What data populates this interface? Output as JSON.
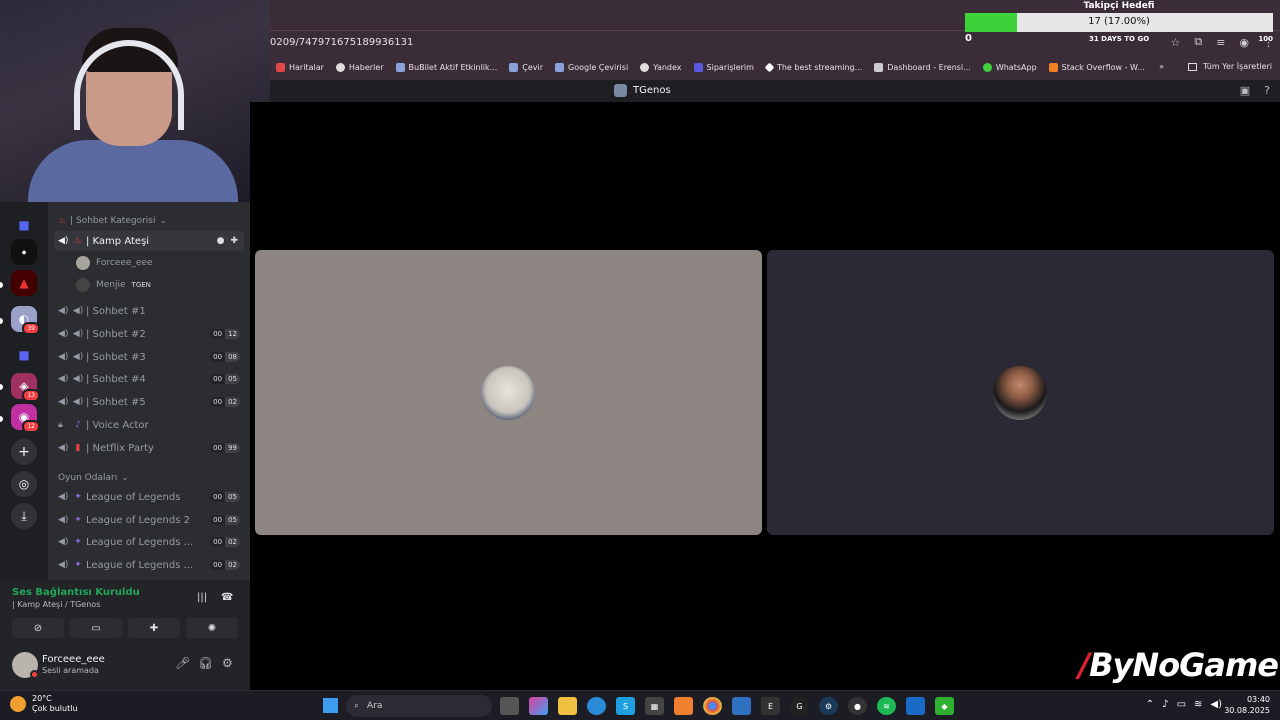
{
  "browser": {
    "address": "0209/747971675189936131",
    "bookmarks": [
      "Haritalar",
      "Haberler",
      "BuBilet Aktif Etkinlik...",
      "Çevir",
      "Google Çevirisi",
      "Yandex",
      "Siparişlerim",
      "The best streaming...",
      "Dashboard - Erensi...",
      "WhatsApp",
      "Stack Overflow - W..."
    ],
    "more": "»",
    "all_bookmarks": "Tüm Yer İşaretleri"
  },
  "discord": {
    "server_title": "TGenos",
    "categories": {
      "sohbet": "| Sohbet Kategorisi",
      "oyun": "Oyun Odaları"
    },
    "active_channel": "| Kamp Ateşi",
    "voice_users": [
      {
        "name": "Forceee_eee",
        "tag": ""
      },
      {
        "name": "Menjie",
        "tag": "TGEN"
      }
    ],
    "channels": [
      {
        "name": "| Sohbet #1",
        "a": "",
        "b": ""
      },
      {
        "name": "| Sohbet #2",
        "a": "00",
        "b": "12"
      },
      {
        "name": "| Sohbet #3",
        "a": "00",
        "b": "08"
      },
      {
        "name": "| Sohbet #4",
        "a": "00",
        "b": "05"
      },
      {
        "name": "| Sohbet #5",
        "a": "00",
        "b": "02"
      },
      {
        "name": "| Voice Actor",
        "a": "",
        "b": ""
      },
      {
        "name": "| Netflix Party",
        "a": "00",
        "b": "99"
      }
    ],
    "game_channels": [
      {
        "name": "League of Legends",
        "a": "00",
        "b": "05"
      },
      {
        "name": "League of Legends 2",
        "a": "00",
        "b": "05"
      },
      {
        "name": "League of Legends ...",
        "a": "00",
        "b": "02"
      },
      {
        "name": "League of Legends ...",
        "a": "00",
        "b": "02"
      }
    ],
    "server_badges": [
      "39",
      "13",
      "12"
    ],
    "voice_status": "Ses Bağlantısı Kuruldu",
    "voice_channel_path": "| Kamp Ateşi / TGenos",
    "user": {
      "name": "Forceee_eee",
      "status": "Sesli aramada"
    }
  },
  "follower_goal": {
    "title": "Takipçi Hedefi",
    "progress_text": "17 (17.00%)",
    "fraction": 0.17,
    "min": "0",
    "days_left": "31 DAYS TO GO",
    "max": "100"
  },
  "watermark": {
    "slash": "/",
    "text": "ByNoGame"
  },
  "taskbar": {
    "temperature": "20°C",
    "weather": "Çok bulutlu",
    "search_placeholder": "Ara",
    "time": "03:40",
    "date": "30.08.2025"
  },
  "colors": {
    "accent_green": "#23a55a",
    "goal_green": "#3ed23a",
    "tile_left": "#8c8582",
    "tile_right": "#2b2a34"
  }
}
